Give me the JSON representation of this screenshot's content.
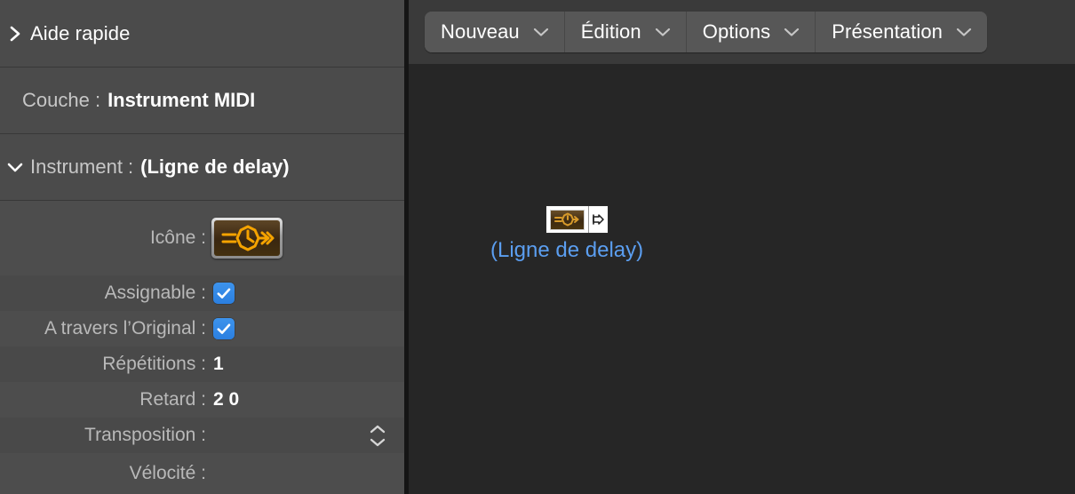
{
  "sidebar": {
    "sections": [
      {
        "name": "quick-help",
        "title": "Aide rapide",
        "expanded": false,
        "chevron": "chevron-right-icon"
      }
    ],
    "layer_row": {
      "label": "Couche :",
      "value": "Instrument MIDI"
    },
    "instrument_header": {
      "label": "Instrument :",
      "value": "(Ligne de delay)",
      "chevron": "chevron-down-icon"
    },
    "params": [
      {
        "name": "icon",
        "label": "Icône :",
        "control": "icon-picker",
        "icon": "delay-clock-icon"
      },
      {
        "name": "assignable",
        "label": "Assignable :",
        "control": "checkbox",
        "checked": true
      },
      {
        "name": "thru-original",
        "label": "A travers l’Original :",
        "control": "checkbox",
        "checked": true
      },
      {
        "name": "repetitions",
        "label": "Répétitions :",
        "control": "value",
        "value": "1"
      },
      {
        "name": "delay",
        "label": "Retard :",
        "control": "value",
        "value": "2 0"
      },
      {
        "name": "transposition",
        "label": "Transposition :",
        "control": "stepper",
        "value": ""
      },
      {
        "name": "velocity",
        "label": "Vélocité :",
        "control": "value",
        "value": ""
      }
    ]
  },
  "toolbar": {
    "buttons": [
      {
        "name": "nouveau",
        "label": "Nouveau",
        "chevron": "chevron-down-icon"
      },
      {
        "name": "edition",
        "label": "Édition",
        "chevron": "chevron-down-icon"
      },
      {
        "name": "options",
        "label": "Options",
        "chevron": "chevron-down-icon"
      },
      {
        "name": "presentation",
        "label": "Présentation",
        "chevron": "chevron-down-icon"
      }
    ]
  },
  "canvas": {
    "object": {
      "label": "(Ligne de delay)",
      "icon": "delay-clock-icon",
      "port": "output-port-icon"
    }
  },
  "colors": {
    "sidebar_bg": "#4b4b4b",
    "canvas_bg": "#262626",
    "toolbar_bg": "#3a3a3a",
    "toolbar_button": "#575757",
    "accent_checkbox": "#2f86e8",
    "object_label": "#5b9ef0",
    "icon_amber": "#f5a300"
  }
}
